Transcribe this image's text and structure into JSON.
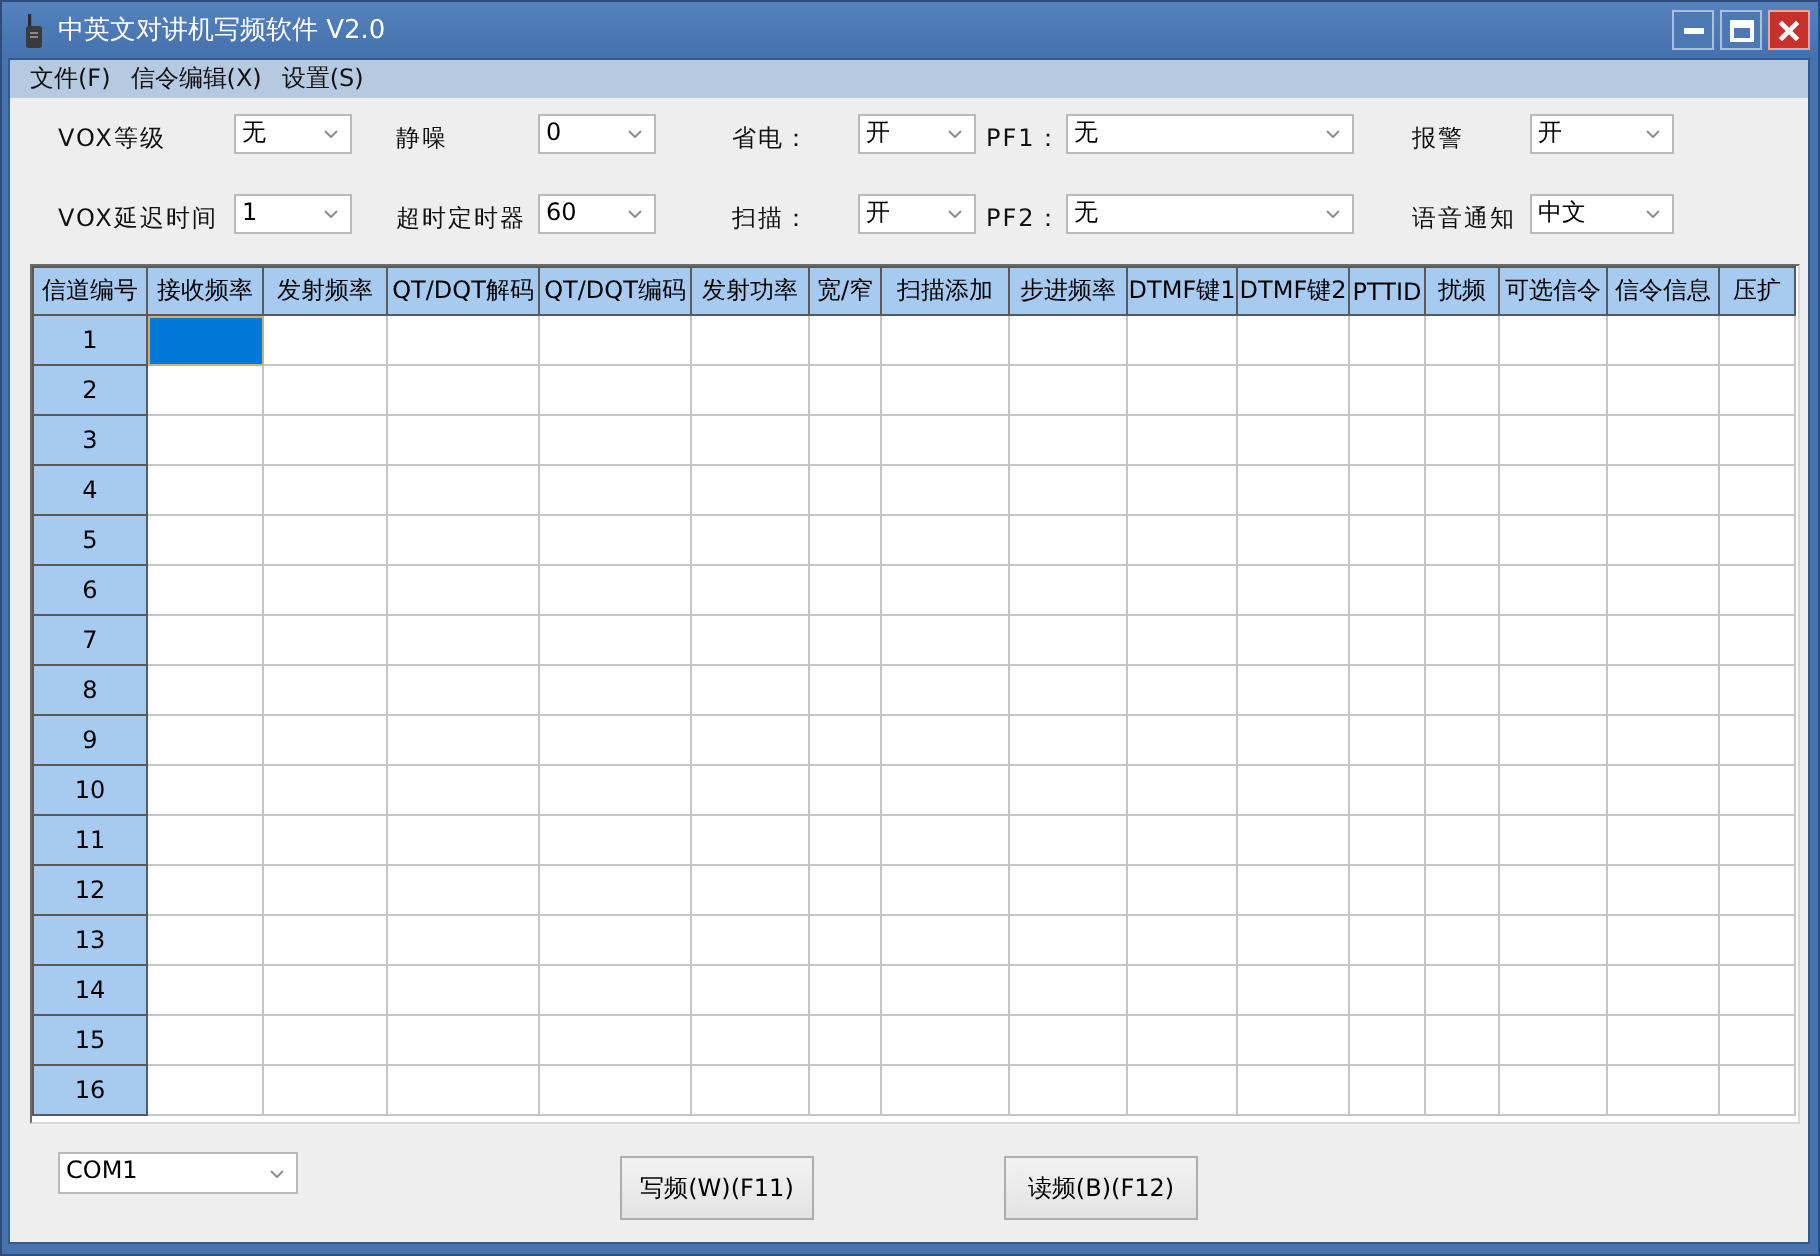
{
  "window": {
    "title": "中英文对讲机写频软件 V2.0"
  },
  "menu": [
    "文件(F)",
    "信令编辑(X)",
    "设置(S)"
  ],
  "settings": {
    "rows": [
      [
        {
          "label": "VOX等级",
          "value": "无"
        },
        {
          "label": "静噪",
          "value": "0"
        },
        {
          "label": "省电：",
          "value": "开"
        },
        {
          "label": "PF1：",
          "value": "无"
        },
        {
          "label": "报警",
          "value": "开"
        }
      ],
      [
        {
          "label": "VOX延迟时间",
          "value": "1"
        },
        {
          "label": "超时定时器",
          "value": "60"
        },
        {
          "label": "扫描：",
          "value": "开"
        },
        {
          "label": "PF2：",
          "value": "无"
        },
        {
          "label": "语音通知",
          "value": "中文"
        }
      ]
    ]
  },
  "table": {
    "columns": [
      "信道编号",
      "接收频率",
      "发射频率",
      "QT/DQT解码",
      "QT/DQT编码",
      "发射功率",
      "宽/窄",
      "扫描添加",
      "步进频率",
      "DTMF键1",
      "DTMF键2",
      "PTTID",
      "扰频",
      "可选信令",
      "信令信息",
      "压扩"
    ],
    "rows": [
      {
        "label": "1",
        "cells": [
          {
            "selected": true
          },
          {
            "selected": false
          },
          {
            "selected": false
          },
          {
            "selected": false
          },
          {
            "selected": false
          },
          {
            "selected": false
          },
          {
            "selected": false
          },
          {
            "selected": false
          },
          {
            "selected": false
          },
          {
            "selected": false
          },
          {
            "selected": false
          },
          {
            "selected": false
          },
          {
            "selected": false
          },
          {
            "selected": false
          },
          {
            "selected": false
          }
        ]
      },
      {
        "label": "2",
        "cells": [
          {
            "selected": false
          },
          {
            "selected": false
          },
          {
            "selected": false
          },
          {
            "selected": false
          },
          {
            "selected": false
          },
          {
            "selected": false
          },
          {
            "selected": false
          },
          {
            "selected": false
          },
          {
            "selected": false
          },
          {
            "selected": false
          },
          {
            "selected": false
          },
          {
            "selected": false
          },
          {
            "selected": false
          },
          {
            "selected": false
          },
          {
            "selected": false
          }
        ]
      },
      {
        "label": "3",
        "cells": [
          {
            "selected": false
          },
          {
            "selected": false
          },
          {
            "selected": false
          },
          {
            "selected": false
          },
          {
            "selected": false
          },
          {
            "selected": false
          },
          {
            "selected": false
          },
          {
            "selected": false
          },
          {
            "selected": false
          },
          {
            "selected": false
          },
          {
            "selected": false
          },
          {
            "selected": false
          },
          {
            "selected": false
          },
          {
            "selected": false
          },
          {
            "selected": false
          }
        ]
      },
      {
        "label": "4",
        "cells": [
          {
            "selected": false
          },
          {
            "selected": false
          },
          {
            "selected": false
          },
          {
            "selected": false
          },
          {
            "selected": false
          },
          {
            "selected": false
          },
          {
            "selected": false
          },
          {
            "selected": false
          },
          {
            "selected": false
          },
          {
            "selected": false
          },
          {
            "selected": false
          },
          {
            "selected": false
          },
          {
            "selected": false
          },
          {
            "selected": false
          },
          {
            "selected": false
          }
        ]
      },
      {
        "label": "5",
        "cells": [
          {
            "selected": false
          },
          {
            "selected": false
          },
          {
            "selected": false
          },
          {
            "selected": false
          },
          {
            "selected": false
          },
          {
            "selected": false
          },
          {
            "selected": false
          },
          {
            "selected": false
          },
          {
            "selected": false
          },
          {
            "selected": false
          },
          {
            "selected": false
          },
          {
            "selected": false
          },
          {
            "selected": false
          },
          {
            "selected": false
          },
          {
            "selected": false
          }
        ]
      },
      {
        "label": "6",
        "cells": [
          {
            "selected": false
          },
          {
            "selected": false
          },
          {
            "selected": false
          },
          {
            "selected": false
          },
          {
            "selected": false
          },
          {
            "selected": false
          },
          {
            "selected": false
          },
          {
            "selected": false
          },
          {
            "selected": false
          },
          {
            "selected": false
          },
          {
            "selected": false
          },
          {
            "selected": false
          },
          {
            "selected": false
          },
          {
            "selected": false
          },
          {
            "selected": false
          }
        ]
      },
      {
        "label": "7",
        "cells": [
          {
            "selected": false
          },
          {
            "selected": false
          },
          {
            "selected": false
          },
          {
            "selected": false
          },
          {
            "selected": false
          },
          {
            "selected": false
          },
          {
            "selected": false
          },
          {
            "selected": false
          },
          {
            "selected": false
          },
          {
            "selected": false
          },
          {
            "selected": false
          },
          {
            "selected": false
          },
          {
            "selected": false
          },
          {
            "selected": false
          },
          {
            "selected": false
          }
        ]
      },
      {
        "label": "8",
        "cells": [
          {
            "selected": false
          },
          {
            "selected": false
          },
          {
            "selected": false
          },
          {
            "selected": false
          },
          {
            "selected": false
          },
          {
            "selected": false
          },
          {
            "selected": false
          },
          {
            "selected": false
          },
          {
            "selected": false
          },
          {
            "selected": false
          },
          {
            "selected": false
          },
          {
            "selected": false
          },
          {
            "selected": false
          },
          {
            "selected": false
          },
          {
            "selected": false
          }
        ]
      },
      {
        "label": "9",
        "cells": [
          {
            "selected": false
          },
          {
            "selected": false
          },
          {
            "selected": false
          },
          {
            "selected": false
          },
          {
            "selected": false
          },
          {
            "selected": false
          },
          {
            "selected": false
          },
          {
            "selected": false
          },
          {
            "selected": false
          },
          {
            "selected": false
          },
          {
            "selected": false
          },
          {
            "selected": false
          },
          {
            "selected": false
          },
          {
            "selected": false
          },
          {
            "selected": false
          }
        ]
      },
      {
        "label": "10",
        "cells": [
          {
            "selected": false
          },
          {
            "selected": false
          },
          {
            "selected": false
          },
          {
            "selected": false
          },
          {
            "selected": false
          },
          {
            "selected": false
          },
          {
            "selected": false
          },
          {
            "selected": false
          },
          {
            "selected": false
          },
          {
            "selected": false
          },
          {
            "selected": false
          },
          {
            "selected": false
          },
          {
            "selected": false
          },
          {
            "selected": false
          },
          {
            "selected": false
          }
        ]
      },
      {
        "label": "11",
        "cells": [
          {
            "selected": false
          },
          {
            "selected": false
          },
          {
            "selected": false
          },
          {
            "selected": false
          },
          {
            "selected": false
          },
          {
            "selected": false
          },
          {
            "selected": false
          },
          {
            "selected": false
          },
          {
            "selected": false
          },
          {
            "selected": false
          },
          {
            "selected": false
          },
          {
            "selected": false
          },
          {
            "selected": false
          },
          {
            "selected": false
          },
          {
            "selected": false
          }
        ]
      },
      {
        "label": "12",
        "cells": [
          {
            "selected": false
          },
          {
            "selected": false
          },
          {
            "selected": false
          },
          {
            "selected": false
          },
          {
            "selected": false
          },
          {
            "selected": false
          },
          {
            "selected": false
          },
          {
            "selected": false
          },
          {
            "selected": false
          },
          {
            "selected": false
          },
          {
            "selected": false
          },
          {
            "selected": false
          },
          {
            "selected": false
          },
          {
            "selected": false
          },
          {
            "selected": false
          }
        ]
      },
      {
        "label": "13",
        "cells": [
          {
            "selected": false
          },
          {
            "selected": false
          },
          {
            "selected": false
          },
          {
            "selected": false
          },
          {
            "selected": false
          },
          {
            "selected": false
          },
          {
            "selected": false
          },
          {
            "selected": false
          },
          {
            "selected": false
          },
          {
            "selected": false
          },
          {
            "selected": false
          },
          {
            "selected": false
          },
          {
            "selected": false
          },
          {
            "selected": false
          },
          {
            "selected": false
          }
        ]
      },
      {
        "label": "14",
        "cells": [
          {
            "selected": false
          },
          {
            "selected": false
          },
          {
            "selected": false
          },
          {
            "selected": false
          },
          {
            "selected": false
          },
          {
            "selected": false
          },
          {
            "selected": false
          },
          {
            "selected": false
          },
          {
            "selected": false
          },
          {
            "selected": false
          },
          {
            "selected": false
          },
          {
            "selected": false
          },
          {
            "selected": false
          },
          {
            "selected": false
          },
          {
            "selected": false
          }
        ]
      },
      {
        "label": "15",
        "cells": [
          {
            "selected": false
          },
          {
            "selected": false
          },
          {
            "selected": false
          },
          {
            "selected": false
          },
          {
            "selected": false
          },
          {
            "selected": false
          },
          {
            "selected": false
          },
          {
            "selected": false
          },
          {
            "selected": false
          },
          {
            "selected": false
          },
          {
            "selected": false
          },
          {
            "selected": false
          },
          {
            "selected": false
          },
          {
            "selected": false
          },
          {
            "selected": false
          }
        ]
      },
      {
        "label": "16",
        "cells": [
          {
            "selected": false
          },
          {
            "selected": false
          },
          {
            "selected": false
          },
          {
            "selected": false
          },
          {
            "selected": false
          },
          {
            "selected": false
          },
          {
            "selected": false
          },
          {
            "selected": false
          },
          {
            "selected": false
          },
          {
            "selected": false
          },
          {
            "selected": false
          },
          {
            "selected": false
          },
          {
            "selected": false
          },
          {
            "selected": false
          },
          {
            "selected": false
          }
        ]
      }
    ]
  },
  "port": {
    "value": "COM1"
  },
  "buttons": [
    "写频(W)(F11)",
    "读频(B)(F12)"
  ]
}
